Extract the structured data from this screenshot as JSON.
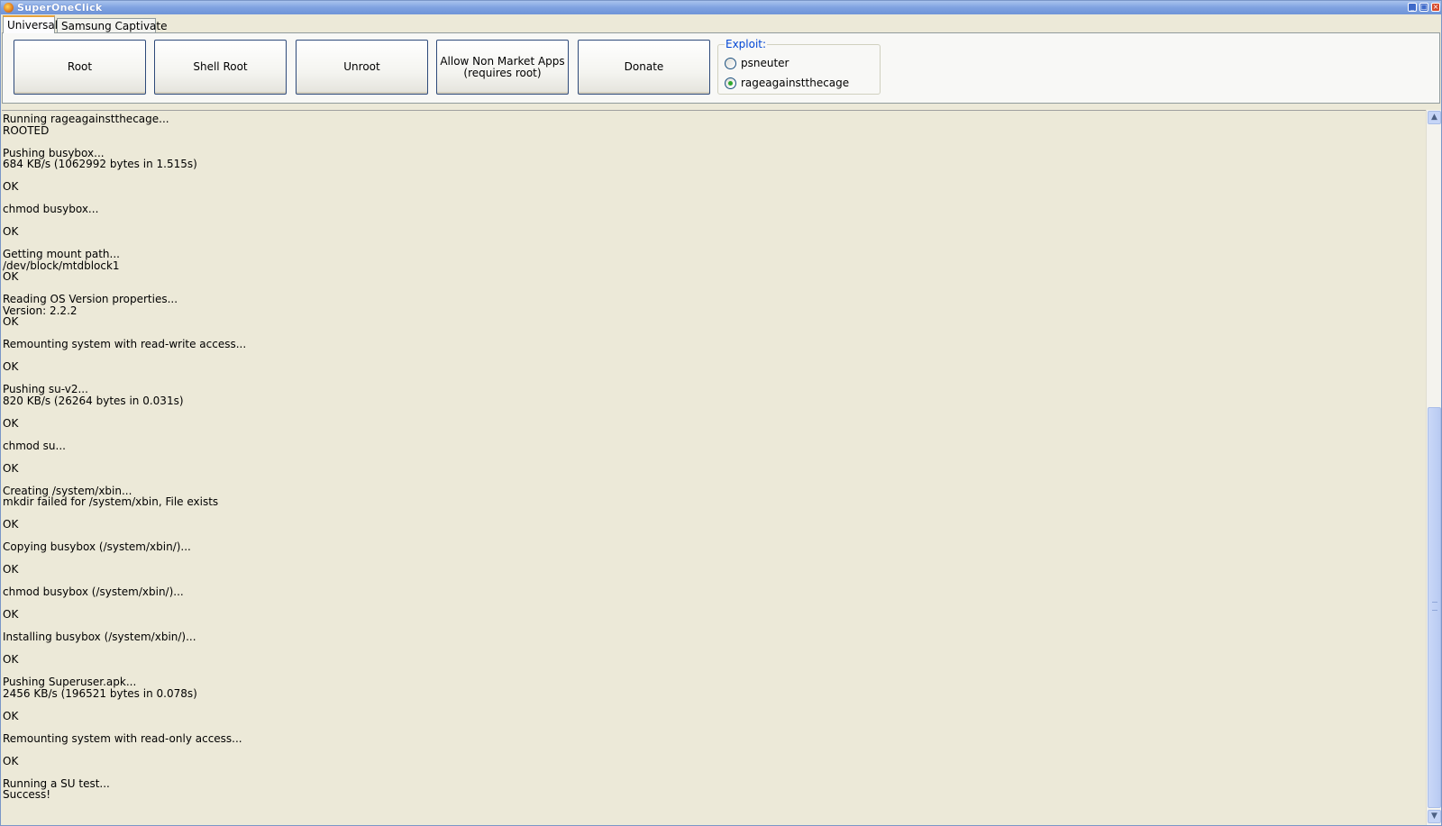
{
  "window": {
    "title": "SuperOneClick"
  },
  "tabs": [
    {
      "label": "Universal",
      "active": true
    },
    {
      "label": "Samsung Captivate",
      "active": false
    }
  ],
  "toolbar": {
    "root_label": "Root",
    "shell_root_label": "Shell Root",
    "unroot_label": "Unroot",
    "allow_non_market_label": "Allow Non Market Apps\n(requires root)",
    "donate_label": "Donate"
  },
  "exploit": {
    "legend": "Exploit:",
    "options": [
      {
        "label": "psneuter",
        "checked": false
      },
      {
        "label": "rageagainstthecage",
        "checked": true
      }
    ]
  },
  "log": {
    "lines": [
      "Running rageagainstthecage...",
      "ROOTED",
      "",
      "Pushing busybox...",
      "684 KB/s (1062992 bytes in 1.515s)",
      "",
      "OK",
      "",
      "chmod busybox...",
      "",
      "OK",
      "",
      "Getting mount path...",
      "/dev/block/mtdblock1",
      "OK",
      "",
      "Reading OS Version properties...",
      "Version: 2.2.2",
      "OK",
      "",
      "Remounting system with read-write access...",
      "",
      "OK",
      "",
      "Pushing su-v2...",
      "820 KB/s (26264 bytes in 0.031s)",
      "",
      "OK",
      "",
      "chmod su...",
      "",
      "OK",
      "",
      "Creating /system/xbin...",
      "mkdir failed for /system/xbin, File exists",
      "",
      "OK",
      "",
      "Copying busybox (/system/xbin/)...",
      "",
      "OK",
      "",
      "chmod busybox (/system/xbin/)...",
      "",
      "OK",
      "",
      "Installing busybox (/system/xbin/)...",
      "",
      "OK",
      "",
      "Pushing Superuser.apk...",
      "2456 KB/s (196521 bytes in 0.078s)",
      "",
      "OK",
      "",
      "Remounting system with read-only access...",
      "",
      "OK",
      "",
      "Running a SU test...",
      "Success!"
    ]
  },
  "icons": {
    "app": "superoneclick-icon",
    "minimize": "minimize-icon",
    "maximize": "maximize-icon",
    "close": "close-icon",
    "scroll_up": "chevron-up-icon",
    "scroll_down": "chevron-down-icon"
  }
}
